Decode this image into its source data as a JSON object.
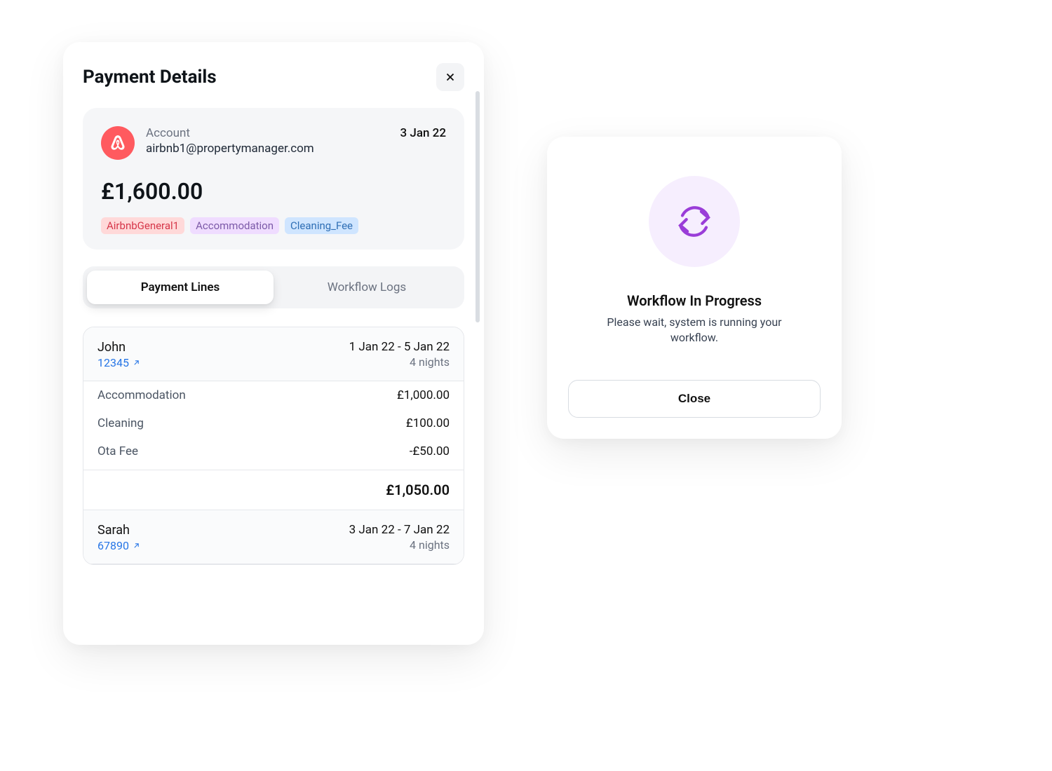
{
  "payment": {
    "title": "Payment Details",
    "account_label": "Account",
    "account_email": "airbnb1@propertymanager.com",
    "date": "3 Jan 22",
    "amount": "£1,600.00",
    "tags": {
      "a": "AirbnbGeneral1",
      "b": "Accommodation",
      "c": "Cleaning_Fee"
    },
    "tabs": {
      "lines": "Payment Lines",
      "logs": "Workflow Logs"
    },
    "entries": [
      {
        "name": "John",
        "ref": "12345",
        "range": "1 Jan 22 - 5 Jan 22",
        "nights": "4 nights",
        "items": [
          {
            "label": "Accommodation",
            "value": "£1,000.00"
          },
          {
            "label": "Cleaning",
            "value": "£100.00"
          },
          {
            "label": "Ota Fee",
            "value": "-£50.00"
          }
        ],
        "total": "£1,050.00"
      },
      {
        "name": "Sarah",
        "ref": "67890",
        "range": "3 Jan 22 - 7 Jan 22",
        "nights": "4 nights"
      }
    ]
  },
  "workflow": {
    "title": "Workflow In Progress",
    "subtitle": "Please wait, system is running your workflow.",
    "close": "Close"
  }
}
